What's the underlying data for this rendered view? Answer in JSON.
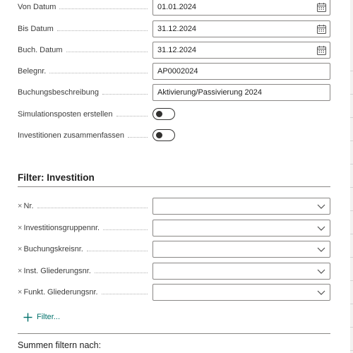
{
  "fields": [
    {
      "label": "Von Datum",
      "value": "01.01.2024",
      "icon": "calendar-icon"
    },
    {
      "label": "Bis Datum",
      "value": "31.12.2024",
      "icon": "calendar-icon"
    },
    {
      "label": "Buch. Datum",
      "value": "31.12.2024",
      "icon": "calendar-icon"
    },
    {
      "label": "Belegnr.",
      "value": "AP0002024"
    },
    {
      "label": "Buchungsbeschreibung",
      "value": "Aktivierung/Passivierung 2024"
    }
  ],
  "toggles": [
    {
      "label": "Simulationsposten erstellen",
      "on": false
    },
    {
      "label": "Investitionen zusammenfassen",
      "on": false
    }
  ],
  "filter_section": {
    "title": "Filter: Investition",
    "remove_glyph": "×",
    "rows": [
      {
        "label": "Nr.",
        "value": ""
      },
      {
        "label": "Investitionsgruppennr.",
        "value": ""
      },
      {
        "label": "Buchungskreisnr.",
        "value": ""
      },
      {
        "label": "Inst. Gliederungsnr.",
        "value": ""
      },
      {
        "label": "Funkt. Gliederungsnr.",
        "value": ""
      }
    ],
    "add_filter_label": "Filter..."
  },
  "totals_section": {
    "title": "Summen filtern nach:"
  },
  "colors": {
    "accent": "#00716b",
    "border": "#8a8886",
    "text": "#212121"
  }
}
